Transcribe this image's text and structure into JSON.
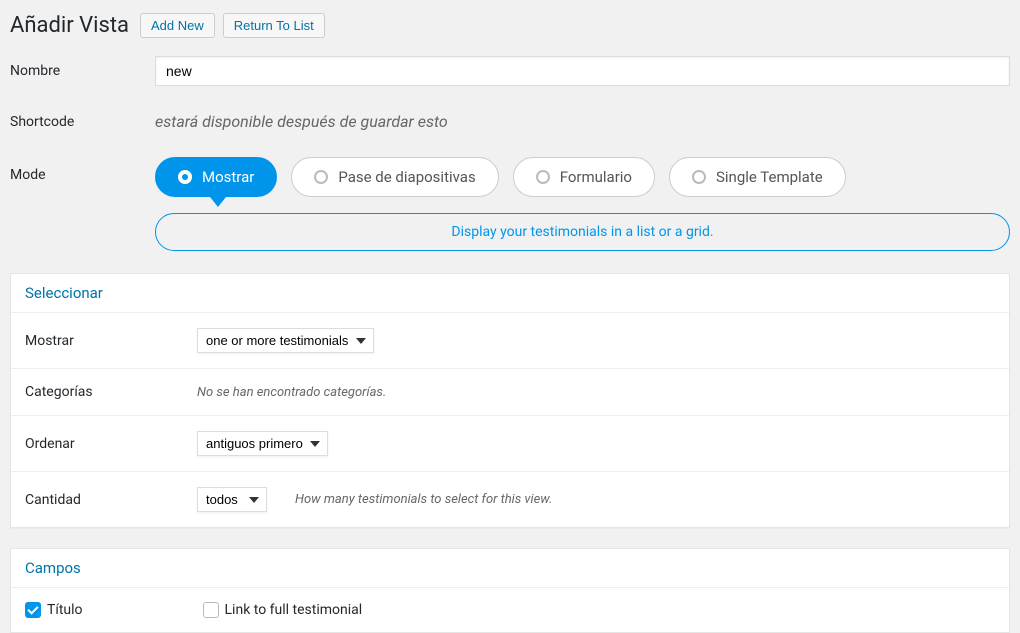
{
  "header": {
    "title": "Añadir Vista",
    "add_new": "Add New",
    "return_to_list": "Return To List"
  },
  "form": {
    "name_label": "Nombre",
    "name_value": "new",
    "shortcode_label": "Shortcode",
    "shortcode_text": "estará disponible después de guardar esto",
    "mode_label": "Mode"
  },
  "modes": {
    "display": "Mostrar",
    "slideshow": "Pase de diapositivas",
    "form": "Formulario",
    "single_template": "Single Template",
    "description": "Display your testimonials in a list or a grid."
  },
  "select_panel": {
    "title": "Seleccionar",
    "show_label": "Mostrar",
    "show_value": "one or more testimonials",
    "categories_label": "Categorías",
    "categories_text": "No se han encontrado categorías.",
    "order_label": "Ordenar",
    "order_value": "antiguos primero",
    "quantity_label": "Cantidad",
    "quantity_value": "todos",
    "quantity_note": "How many testimonials to select for this view."
  },
  "fields_panel": {
    "title": "Campos",
    "title_field": "Título",
    "link_field": "Link to full testimonial"
  }
}
